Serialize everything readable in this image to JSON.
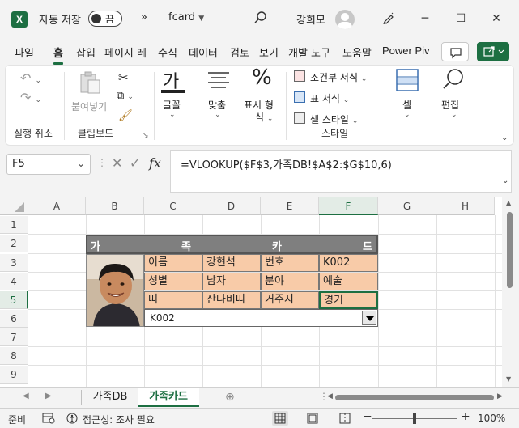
{
  "titlebar": {
    "app_icon": "X",
    "autosave_label": "자동 저장",
    "autosave_state": "끔",
    "more": "»",
    "filename": "fcard",
    "user": "강희모",
    "minimize": "─",
    "maximize": "☐",
    "close": "✕"
  },
  "tabs": [
    "파일",
    "홈",
    "삽입",
    "페이지 레",
    "수식",
    "데이터",
    "검토",
    "보기",
    "개발 도구",
    "도움말",
    "Power Piv"
  ],
  "active_tab": "홈",
  "ribbon": {
    "undo_group_label": "실행 취소",
    "paste_label": "붙여넣기",
    "clipboard_label": "클립보드",
    "font_icon": "가",
    "font_label": "글꼴",
    "align_label": "맞춤",
    "number_icon": "%",
    "number_label_1": "표시 형",
    "number_label_2": "식",
    "cond_format": "조건부 서식",
    "table_format": "표 서식",
    "cell_style": "셀 스타일",
    "style_label": "스타일",
    "cells_label": "셀",
    "edit_label": "편집"
  },
  "formula_bar": {
    "name_box": "F5",
    "fx": "fx",
    "formula": "=VLOOKUP($F$3,가족DB!$A$2:$G$10,6)"
  },
  "columns": [
    "A",
    "B",
    "C",
    "D",
    "E",
    "F",
    "G",
    "H"
  ],
  "rows": [
    "1",
    "2",
    "3",
    "4",
    "5",
    "6",
    "7",
    "8",
    "9"
  ],
  "selected": {
    "col": "F",
    "row": "5"
  },
  "card": {
    "header_chars": [
      "가",
      "족",
      "카",
      "드"
    ],
    "fields": [
      [
        "이름",
        "강현석",
        "번호",
        "K002"
      ],
      [
        "성별",
        "남자",
        "분야",
        "예술"
      ],
      [
        "띠",
        "잔나비띠",
        "거주지",
        "경기"
      ]
    ],
    "combo_value": "K002"
  },
  "sheets": [
    "가족DB",
    "가족카드"
  ],
  "active_sheet": "가족카드",
  "status": {
    "ready": "준비",
    "accessibility": "접근성: 조사 필요",
    "zoom": "100%"
  },
  "colors": {
    "accent": "#1d6f42",
    "card_fill": "#f8cba8",
    "header_fill": "#7f7f7f"
  }
}
